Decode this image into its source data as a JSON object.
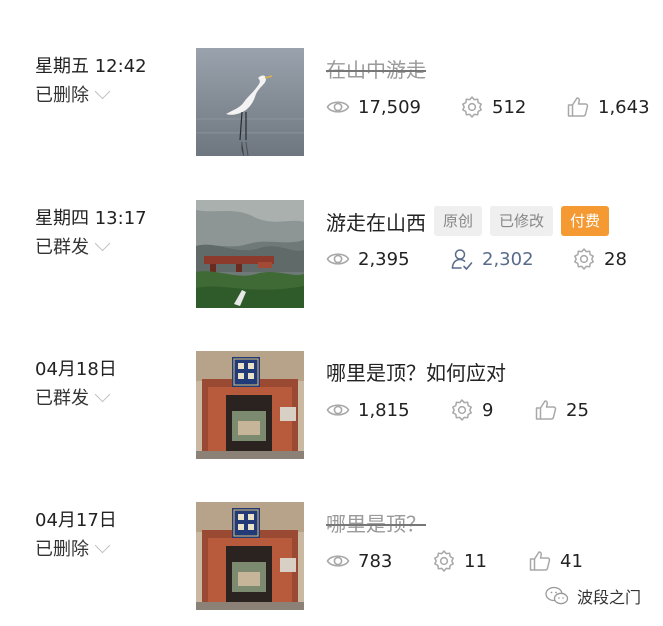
{
  "rows": [
    {
      "date": "星期五 12:42",
      "status": "已删除",
      "title": "在山中游走",
      "stats": [
        "17,509",
        "512",
        "1,643"
      ]
    },
    {
      "date": "星期四 13:17",
      "status": "已群发",
      "title": "游走在山西",
      "tags": [
        "原创",
        "已修改",
        "付费"
      ],
      "stats": [
        "2,395",
        "2,302",
        "28"
      ]
    },
    {
      "date": "04月18日",
      "status": "已群发",
      "title": "哪里是顶？如何应对",
      "stats": [
        "1,815",
        "9",
        "25"
      ]
    },
    {
      "date": "04月17日",
      "status": "已删除",
      "title": "哪里是顶？",
      "stats": [
        "783",
        "11",
        "41"
      ]
    }
  ],
  "watermark": "波段之门",
  "colors": {
    "accent_orange": "#f59a32",
    "tag_grey_bg": "#efefef",
    "icon_grey": "#a8a8a8",
    "follow_blue": "#596b8c"
  },
  "icons": [
    "eye-icon",
    "gear-icon",
    "thumbs-up-icon",
    "follow-user-icon",
    "chevron-down-icon",
    "wechat-icon"
  ]
}
